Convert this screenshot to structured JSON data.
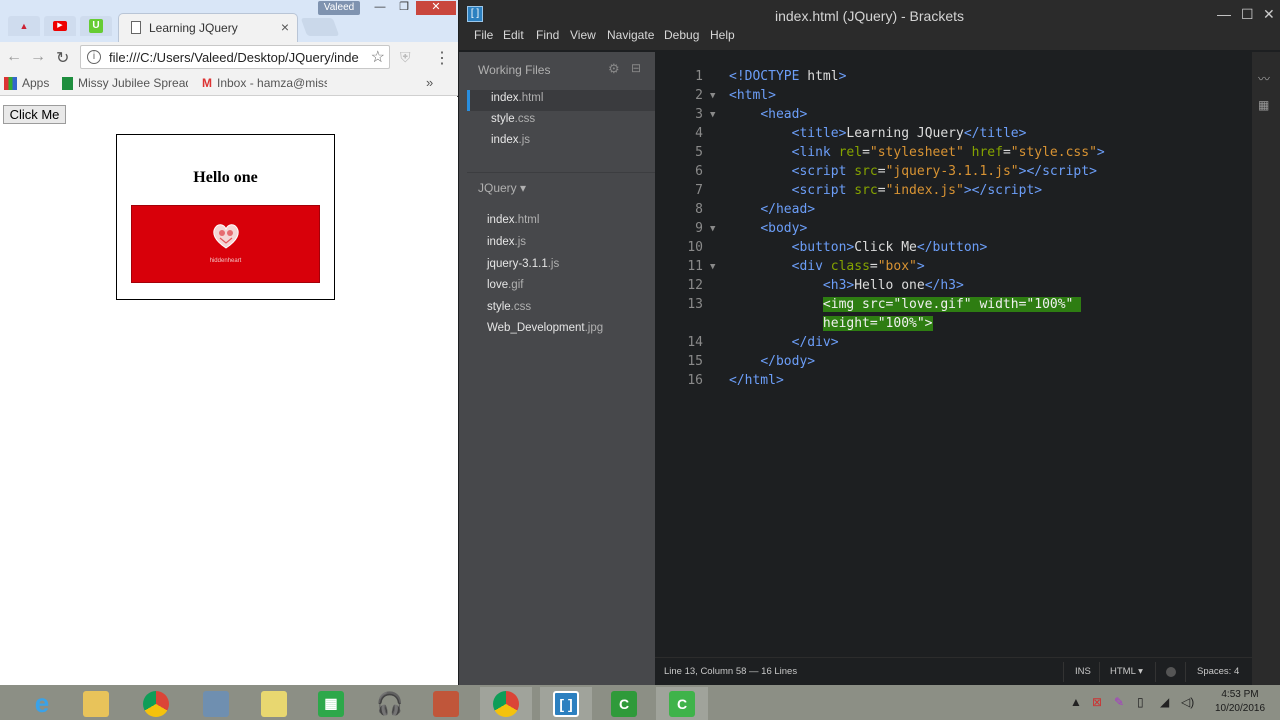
{
  "browser": {
    "tab_title": "Learning JQuery",
    "user_badge": "Valeed",
    "tab_close": "×",
    "address": "file:///C:/Users/Valeed/Desktop/JQuery/inde",
    "bookmarks": [
      {
        "label": "Apps",
        "icon": "apps-grid-icon"
      },
      {
        "label": "Missy Jubilee Spreads",
        "icon": "sheets-icon"
      },
      {
        "label": "Inbox - hamza@miss",
        "icon": "gmail-icon"
      }
    ],
    "page": {
      "button_label": "Click Me",
      "heading": "Hello one",
      "image_caption": "hiddenheart"
    }
  },
  "editor": {
    "window_title": "index.html (JQuery) - Brackets",
    "menu": [
      "File",
      "Edit",
      "Find",
      "View",
      "Navigate",
      "Debug",
      "Help"
    ],
    "working_files_label": "Working Files",
    "working_files": [
      {
        "name": "index",
        "ext": ".html",
        "active": true
      },
      {
        "name": "style",
        "ext": ".css",
        "active": false
      },
      {
        "name": "index",
        "ext": ".js",
        "active": false
      }
    ],
    "project_label": "JQuery ▾",
    "project_files": [
      {
        "name": "index",
        "ext": ".html"
      },
      {
        "name": "index",
        "ext": ".js"
      },
      {
        "name": "jquery-3.1.1",
        "ext": ".js"
      },
      {
        "name": "love",
        "ext": ".gif"
      },
      {
        "name": "style",
        "ext": ".css"
      },
      {
        "name": "Web_Development",
        "ext": ".jpg"
      }
    ],
    "line_numbers": [
      "1",
      "2",
      "3",
      "4",
      "5",
      "6",
      "7",
      "8",
      "9",
      "10",
      "11",
      "12",
      "13",
      "",
      "14",
      "15",
      "16"
    ],
    "status": {
      "cursor": "Line 13, Column 58 — 16 Lines",
      "mode": "INS",
      "language": "HTML ▾",
      "spaces": "Spaces: 4"
    }
  },
  "taskbar": {
    "time": "4:53 PM",
    "date": "10/20/2016"
  },
  "colors": {
    "accent_blue": "#288edf",
    "selection_green": "#2e7d12",
    "tag_blue": "#6c9ef8",
    "attr_green": "#85a300",
    "string_orange": "#d89333",
    "love_red": "#d8000a"
  }
}
